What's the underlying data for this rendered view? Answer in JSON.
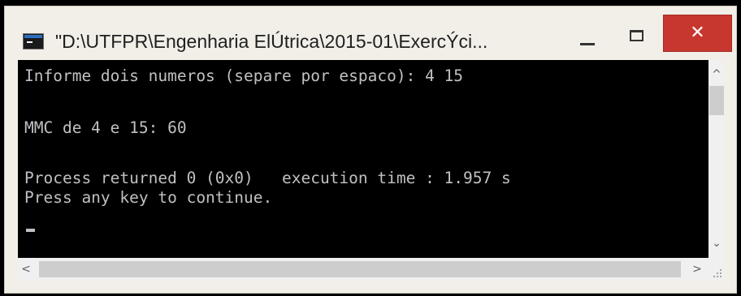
{
  "window": {
    "title": "\"D:\\UTFPR\\Engenharia ElÚtrica\\2015-01\\ExercÝci...",
    "minimize_label": "",
    "maximize_label": "",
    "close_symbol": "✕"
  },
  "console": {
    "lines": [
      "Informe dois numeros (separe por espaco): 4 15",
      "MMC de 4 e 15: 60",
      "Process returned 0 (0x0)   execution time : 1.957 s",
      "Press any key to continue."
    ],
    "text_color": "#c0c0c0",
    "background": "#000000"
  },
  "scrollbars": {
    "up_arrow": "^",
    "down_arrow": "⌄",
    "left_arrow": "<",
    "right_arrow": ">"
  },
  "colors": {
    "close_button": "#c7372f",
    "titlebar": "#f1efe8",
    "frame": "#000000"
  }
}
